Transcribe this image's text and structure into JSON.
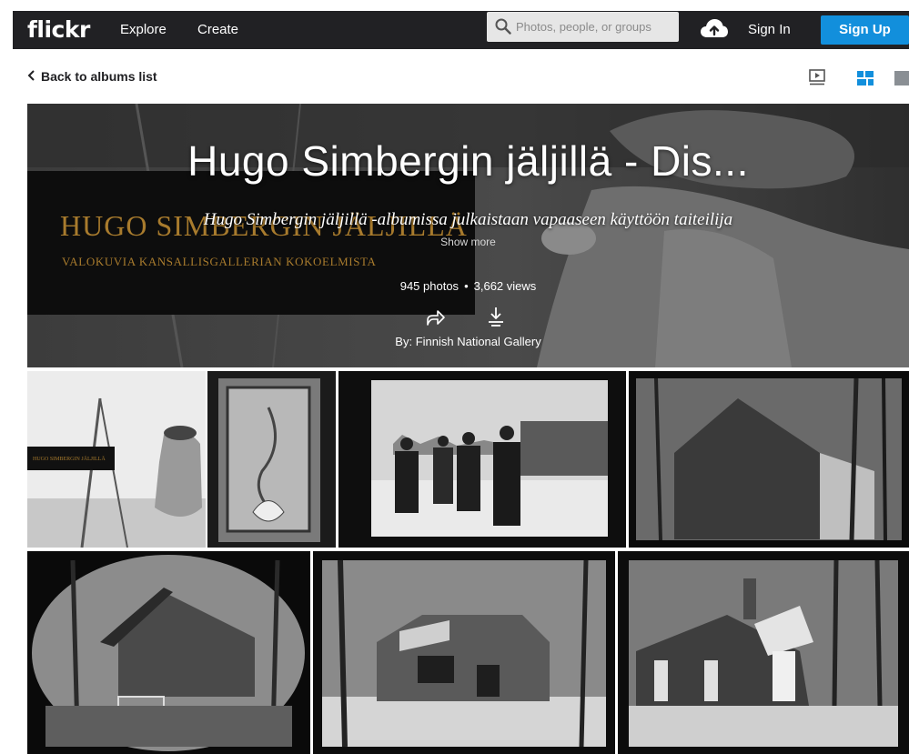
{
  "nav": {
    "logo": "flickr",
    "explore": "Explore",
    "create": "Create",
    "search_placeholder": "Photos, people, or groups",
    "sign_in": "Sign In",
    "sign_up": "Sign Up"
  },
  "subbar": {
    "back_label": "Back to albums list"
  },
  "album": {
    "title": "Hugo Simbergin jäljillä - Dis...",
    "description": "Hugo Simbergin jäljillä -albumissa julkaistaan vapaaseen käyttöön taiteilija",
    "show_more": "Show more",
    "photos": "945 photos",
    "views": "3,662 views",
    "byline": "By: Finnish National Gallery",
    "overlay_title": "HUGO SIMBERGIN JÄLJILLÄ",
    "overlay_subtitle": "VALOKUVIA KANSALLISGALLERIAN KOKOELMISTA"
  },
  "thumb_overlay": "HUGO SIMBERGIN JÄLJILLÄ",
  "colors": {
    "nav_bg": "#212124",
    "signup_blue": "#128fdc",
    "grid_icon_blue": "#128fdc",
    "overlay_gold": "#a87b2d"
  },
  "icons": [
    "search-icon",
    "cloud-upload-icon",
    "chevron-left-icon",
    "slideshow-icon",
    "grid-view-icon",
    "single-view-icon",
    "share-icon",
    "download-icon"
  ]
}
